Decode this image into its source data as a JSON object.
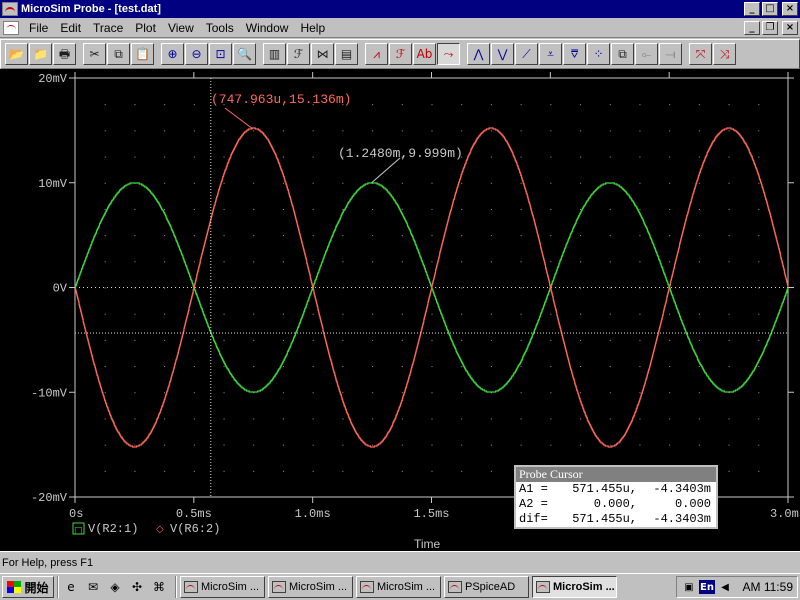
{
  "window": {
    "title": "MicroSim Probe - [test.dat]",
    "min_glyph": "_",
    "max_glyph": "□",
    "close_glyph": "×"
  },
  "doc_controls": {
    "min_glyph": "_",
    "restore_glyph": "❐",
    "close_glyph": "×"
  },
  "menu": {
    "items": [
      {
        "label": "File"
      },
      {
        "label": "Edit"
      },
      {
        "label": "Trace"
      },
      {
        "label": "Plot"
      },
      {
        "label": "View"
      },
      {
        "label": "Tools"
      },
      {
        "label": "Window"
      },
      {
        "label": "Help"
      }
    ]
  },
  "toolbar": {
    "buttons": [
      {
        "name": "open-folder-icon",
        "glyph": "📂",
        "color": "c-dark"
      },
      {
        "name": "open-file-icon",
        "glyph": "📁",
        "color": "c-dark"
      },
      {
        "name": "print-icon",
        "glyph": "🖶",
        "color": "c-dark"
      },
      {
        "sep": true
      },
      {
        "name": "cut-icon",
        "glyph": "✂",
        "color": "c-dark"
      },
      {
        "name": "copy-icon",
        "glyph": "⧉",
        "color": "c-dark"
      },
      {
        "name": "paste-icon",
        "glyph": "📋",
        "color": "c-gray"
      },
      {
        "sep": true
      },
      {
        "name": "zoom-in-icon",
        "glyph": "⊕",
        "color": "c-blue"
      },
      {
        "name": "zoom-out-icon",
        "glyph": "⊖",
        "color": "c-blue"
      },
      {
        "name": "zoom-area-icon",
        "glyph": "⊡",
        "color": "c-blue"
      },
      {
        "name": "zoom-fit-icon",
        "glyph": "🔍",
        "color": "c-dark"
      },
      {
        "sep": true
      },
      {
        "name": "log-x-axis-icon",
        "glyph": "▥",
        "color": "c-dark"
      },
      {
        "name": "fourier-icon",
        "glyph": "ℱ",
        "color": "c-dark"
      },
      {
        "name": "performance-analysis-icon",
        "glyph": "⋈",
        "color": "c-dark"
      },
      {
        "name": "log-y-axis-icon",
        "glyph": "▤",
        "color": "c-dark"
      },
      {
        "sep": true
      },
      {
        "name": "add-trace-icon",
        "glyph": "⩘",
        "color": "c-red"
      },
      {
        "name": "eval-goal-function-icon",
        "glyph": "ℱ",
        "color": "c-red"
      },
      {
        "name": "text-label-icon",
        "glyph": "Ab",
        "color": "c-red"
      },
      {
        "name": "toggle-cursor-icon",
        "glyph": "⤳",
        "color": "c-red",
        "pressed": true
      },
      {
        "sep": true
      },
      {
        "name": "cursor-peak-icon",
        "glyph": "⋀",
        "color": "c-blue"
      },
      {
        "name": "cursor-trough-icon",
        "glyph": "⋁",
        "color": "c-blue"
      },
      {
        "name": "cursor-slope-icon",
        "glyph": "⟋",
        "color": "c-blue"
      },
      {
        "name": "cursor-min-icon",
        "glyph": "⩡",
        "color": "c-blue"
      },
      {
        "name": "cursor-max-icon",
        "glyph": "⩢",
        "color": "c-blue"
      },
      {
        "name": "cursor-point-icon",
        "glyph": "⁘",
        "color": "c-blue"
      },
      {
        "name": "cursor-search-icon",
        "glyph": "⧉",
        "color": "c-dark"
      },
      {
        "name": "cursor-next-transition-icon",
        "glyph": "⟜",
        "color": "c-gray"
      },
      {
        "name": "cursor-prev-transition-icon",
        "glyph": "⟞",
        "color": "c-gray"
      },
      {
        "sep": true
      },
      {
        "name": "mark-data-points-icon",
        "glyph": "⤧",
        "color": "c-red"
      },
      {
        "name": "mark-label-icon",
        "glyph": "⤨",
        "color": "c-red"
      }
    ]
  },
  "statusbar": {
    "text": "For Help, press F1"
  },
  "probe_cursor": {
    "title": "Probe Cursor",
    "rows": [
      {
        "label": "A1 =",
        "v1": "571.455u,",
        "v2": "-4.3403m"
      },
      {
        "label": "A2 =",
        "v1": "0.000,",
        "v2": "0.000"
      },
      {
        "label": "dif=",
        "v1": "571.455u,",
        "v2": "-4.3403m"
      }
    ]
  },
  "taskbar": {
    "start_label": "開始",
    "quick_launch": [
      {
        "name": "ie-icon",
        "glyph": "e"
      },
      {
        "name": "outlook-express-icon",
        "glyph": "✉"
      },
      {
        "name": "channels-icon",
        "glyph": "◈"
      },
      {
        "name": "app-shortcut-icon",
        "glyph": "✣"
      },
      {
        "name": "app-shortcut-2-icon",
        "glyph": "⌘"
      }
    ],
    "tasks": [
      {
        "label": "MicroSim ..."
      },
      {
        "label": "MicroSim ..."
      },
      {
        "label": "MicroSim ..."
      },
      {
        "label": "PSpiceAD"
      },
      {
        "label": "MicroSim ...",
        "active": true
      }
    ],
    "tray": {
      "lang": "En",
      "clock": "AM 11:59"
    }
  },
  "colors": {
    "trace1": "#3ddc3d",
    "trace2": "#ff6a5a",
    "grid": "#d0d0d0",
    "axis": "#c8c8c8"
  },
  "chart_data": {
    "type": "line",
    "xlabel": "Time",
    "x_unit": "s",
    "xlim": [
      0,
      0.003
    ],
    "ylim": [
      -0.02,
      0.02
    ],
    "x_ticks": [
      0,
      0.0005,
      0.001,
      0.0015,
      0.002,
      0.0025,
      0.003
    ],
    "x_tick_labels": [
      "0s",
      "0.5ms",
      "1.0ms",
      "1.5ms",
      "",
      "",
      "3.0ms"
    ],
    "y_ticks": [
      0.02,
      0.01,
      0,
      -0.01,
      -0.02
    ],
    "y_tick_labels": [
      "20mV",
      "10mV",
      "0V",
      "-10mV",
      "-20mV"
    ],
    "series": [
      {
        "name": "V(R2:1)",
        "marker": "□",
        "color": "#3ddc3d",
        "amplitude": 0.01,
        "period": 0.001,
        "phase_sign": 1
      },
      {
        "name": "V(R6:2)",
        "marker": "◇",
        "color": "#ff6a5a",
        "amplitude": 0.0152,
        "period": 0.001,
        "phase_sign": -1
      }
    ],
    "cursors": {
      "a1": {
        "x": 0.000571455,
        "y": -0.0043403
      }
    },
    "annotations": [
      {
        "text": "(747.963u,15.136m)",
        "x": 0.000747963,
        "y": 0.015136,
        "color": "#ff6a5a"
      },
      {
        "text": "(1.2480m,9.999m)",
        "x": 0.001248,
        "y": 0.009999,
        "color": "#c8c8c8"
      }
    ]
  }
}
